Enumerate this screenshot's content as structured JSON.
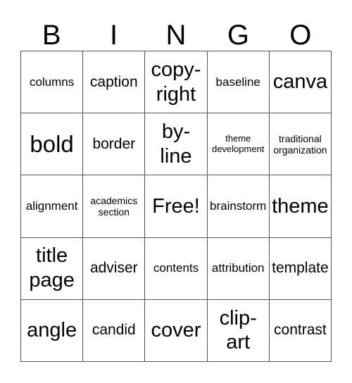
{
  "header": {
    "letters": [
      "B",
      "I",
      "N",
      "G",
      "O"
    ]
  },
  "card": {
    "rows": [
      [
        {
          "text": "columns",
          "size": "s-sm"
        },
        {
          "text": "caption",
          "size": "s-md"
        },
        {
          "text": "copy-\nright",
          "size": "s-lg"
        },
        {
          "text": "baseline",
          "size": "s-sm"
        },
        {
          "text": "canva",
          "size": "s-lg"
        }
      ],
      [
        {
          "text": "bold",
          "size": "s-xl"
        },
        {
          "text": "border",
          "size": "s-md"
        },
        {
          "text": "by-\nline",
          "size": "s-lg"
        },
        {
          "text": "theme\ndevelopment",
          "size": "s-xxs"
        },
        {
          "text": "traditional\norganization",
          "size": "s-xs"
        }
      ],
      [
        {
          "text": "alignment",
          "size": "s-sm"
        },
        {
          "text": "academics\nsection",
          "size": "s-xs"
        },
        {
          "text": "Free!",
          "size": "s-lg"
        },
        {
          "text": "brainstorm",
          "size": "s-sm"
        },
        {
          "text": "theme",
          "size": "s-lg"
        }
      ],
      [
        {
          "text": "title\npage",
          "size": "s-lg"
        },
        {
          "text": "adviser",
          "size": "s-md"
        },
        {
          "text": "contents",
          "size": "s-sm"
        },
        {
          "text": "attribution",
          "size": "s-sm"
        },
        {
          "text": "template",
          "size": "s-md"
        }
      ],
      [
        {
          "text": "angle",
          "size": "s-lg"
        },
        {
          "text": "candid",
          "size": "s-md"
        },
        {
          "text": "cover",
          "size": "s-lg"
        },
        {
          "text": "clip-\nart",
          "size": "s-lg"
        },
        {
          "text": "contrast",
          "size": "s-md"
        }
      ]
    ]
  }
}
